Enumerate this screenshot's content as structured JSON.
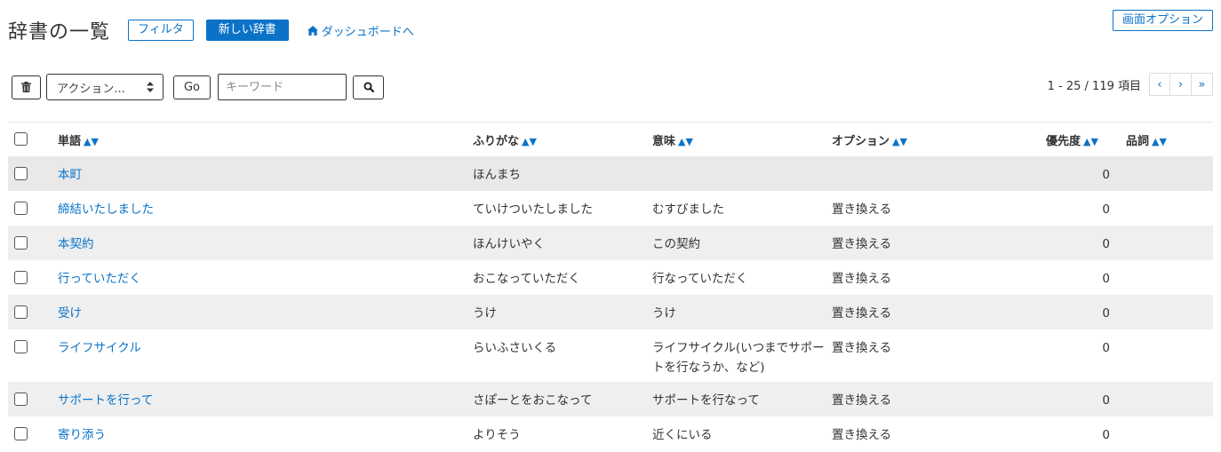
{
  "header": {
    "title": "辞書の一覧",
    "filter_label": "フィルタ",
    "new_label": "新しい辞書",
    "dashboard_label": "ダッシュボードへ",
    "screen_options_label": "画面オプション"
  },
  "toolbar": {
    "action_select": "アクション...",
    "go_label": "Go",
    "keyword_placeholder": "キーワード"
  },
  "pagination": {
    "text": "1 - 25 / 119 項目",
    "prev": "‹",
    "next": "›",
    "last": "»"
  },
  "table": {
    "headers": {
      "word": "単語",
      "reading": "ふりがな",
      "meaning": "意味",
      "option": "オプション",
      "priority": "優先度",
      "pos": "品詞",
      "sort_indicator": "▲▼"
    },
    "rows": [
      {
        "word": "本町",
        "reading": "ほんまち",
        "meaning": "",
        "option": "",
        "priority": "0",
        "pos": ""
      },
      {
        "word": "締結いたしました",
        "reading": "ていけついたしました",
        "meaning": "むすびました",
        "option": "置き換える",
        "priority": "0",
        "pos": ""
      },
      {
        "word": "本契約",
        "reading": "ほんけいやく",
        "meaning": "この契約",
        "option": "置き換える",
        "priority": "0",
        "pos": ""
      },
      {
        "word": "行っていただく",
        "reading": "おこなっていただく",
        "meaning": "行なっていただく",
        "option": "置き換える",
        "priority": "0",
        "pos": ""
      },
      {
        "word": "受け",
        "reading": "うけ",
        "meaning": "うけ",
        "option": "置き換える",
        "priority": "0",
        "pos": ""
      },
      {
        "word": "ライフサイクル",
        "reading": "らいふさいくる",
        "meaning": "ライフサイクル(いつまでサポートを行なうか、など)",
        "option": "置き換える",
        "priority": "0",
        "pos": ""
      },
      {
        "word": "サポートを行って",
        "reading": "さぽーとをおこなって",
        "meaning": "サポートを行なって",
        "option": "置き換える",
        "priority": "0",
        "pos": ""
      },
      {
        "word": "寄り添う",
        "reading": "よりそう",
        "meaning": "近くにいる",
        "option": "置き換える",
        "priority": "0",
        "pos": ""
      }
    ]
  },
  "colors": {
    "accent": "#0b73c7",
    "row_stripe": "#efefef"
  },
  "icons": [
    "home-icon",
    "trash-icon",
    "search-icon",
    "select-arrows-icon"
  ]
}
